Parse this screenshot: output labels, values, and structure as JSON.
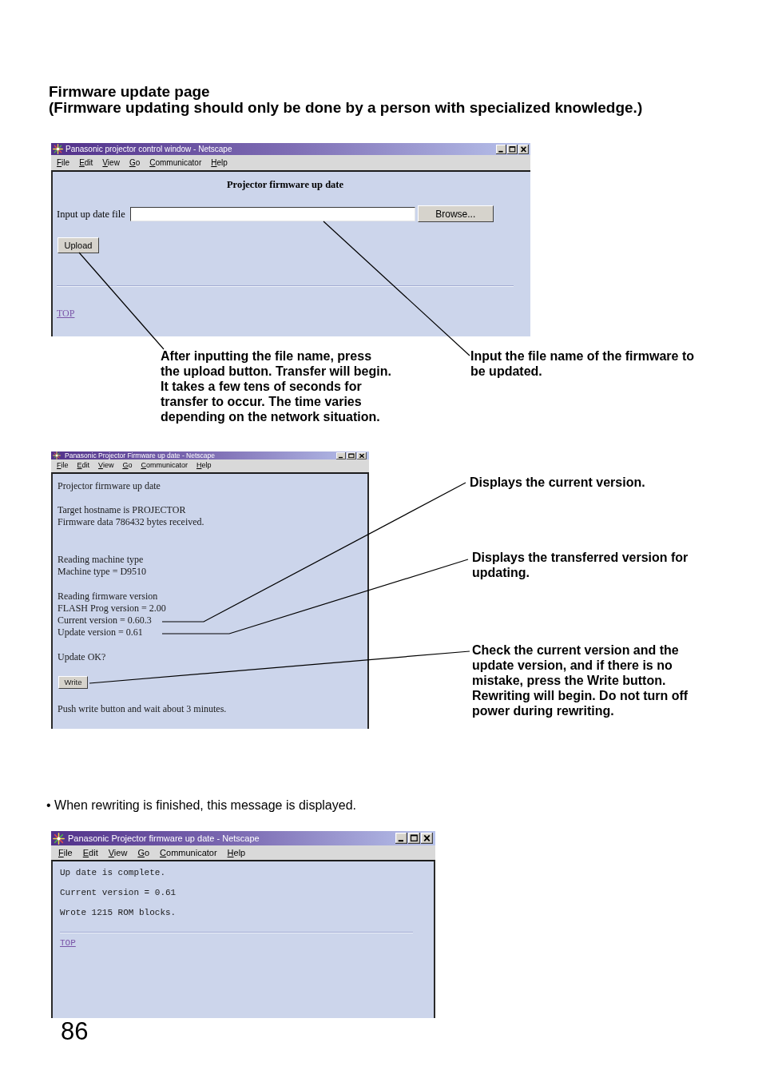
{
  "heading": {
    "title": "Firmware update page",
    "subtitle": "(Firmware updating should only be done by a person with specialized knowledge.)"
  },
  "upload_window": {
    "title": "Panasonic projector control window - Netscape",
    "menu": [
      "File",
      "Edit",
      "View",
      "Go",
      "Communicator",
      "Help"
    ],
    "page_title": "Projector firmware up date",
    "file_label": "Input up date file",
    "browse_button": "Browse...",
    "upload_button": "Upload",
    "link": "TOP"
  },
  "upload_callouts": [
    "After inputting the file name, press\nthe upload button. Transfer will begin.\nIt takes a few tens of seconds for\ntransfer to occur. The time varies\ndepending on the network situation.",
    "Input the file name of the firmware to\nbe updated."
  ],
  "write_window": {
    "title": "Panasonic Projector Firmware up date - Netscape",
    "menu": [
      "File",
      "Edit",
      "View",
      "Go",
      "Communicator",
      "Help"
    ],
    "paragraphs": [
      [
        "Projector firmware up date"
      ],
      [
        "Target hostname is PROJECTOR",
        "Firmware data 786432 bytes received."
      ],
      [
        "Reading machine type",
        "Machine type = D9510"
      ],
      [
        "Reading firmware version",
        "FLASH Prog version = 2.00",
        "Current version = 0.60.3",
        "Update version = 0.61"
      ],
      [
        "Update OK?"
      ]
    ],
    "write_button": "Write",
    "footer": "Push write button and wait about 3 minutes."
  },
  "write_callouts": [
    "Displays the current version.",
    "Displays the transferred version for\nupdating.",
    "Check the current version and the\nupdate version, and if there is no\nmistake, press the Write button.\nRewriting will begin. Do not turn off\npower during rewriting."
  ],
  "note": "• When rewriting is finished, this message is displayed.",
  "complete_window": {
    "title": "Panasonic Projector firmware up date - Netscape",
    "menu": [
      "File",
      "Edit",
      "View",
      "Go",
      "Communicator",
      "Help"
    ],
    "lines": [
      "Up date is complete.",
      "Current version = 0.61",
      "Wrote 1215 ROM blocks."
    ],
    "link": "TOP"
  },
  "page_number": "86"
}
